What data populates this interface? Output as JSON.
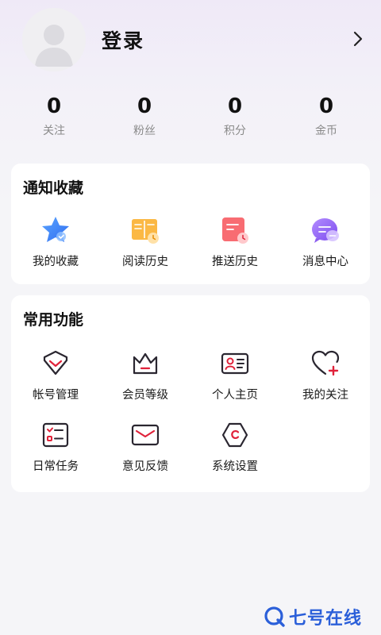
{
  "header": {
    "login_label": "登录"
  },
  "stats": [
    {
      "value": "0",
      "label": "关注"
    },
    {
      "value": "0",
      "label": "粉丝"
    },
    {
      "value": "0",
      "label": "积分"
    },
    {
      "value": "0",
      "label": "金币"
    }
  ],
  "notify_section": {
    "title": "通知收藏",
    "items": [
      {
        "label": "我的收藏",
        "icon": "star-icon"
      },
      {
        "label": "阅读历史",
        "icon": "book-history-icon"
      },
      {
        "label": "推送历史",
        "icon": "push-history-icon"
      },
      {
        "label": "消息中心",
        "icon": "message-icon"
      }
    ]
  },
  "functions_section": {
    "title": "常用功能",
    "items": [
      {
        "label": "帐号管理",
        "icon": "account-icon"
      },
      {
        "label": "会员等级",
        "icon": "crown-icon"
      },
      {
        "label": "个人主页",
        "icon": "id-card-icon"
      },
      {
        "label": "我的关注",
        "icon": "heart-plus-icon"
      },
      {
        "label": "日常任务",
        "icon": "task-list-icon"
      },
      {
        "label": "意见反馈",
        "icon": "mail-icon"
      },
      {
        "label": "系统设置",
        "icon": "settings-icon"
      }
    ]
  },
  "watermark": {
    "text": "七号在线"
  },
  "colors": {
    "accent_red": "#e0223a",
    "icon_dark": "#2a2630",
    "watermark_blue": "#2b5fd9"
  }
}
